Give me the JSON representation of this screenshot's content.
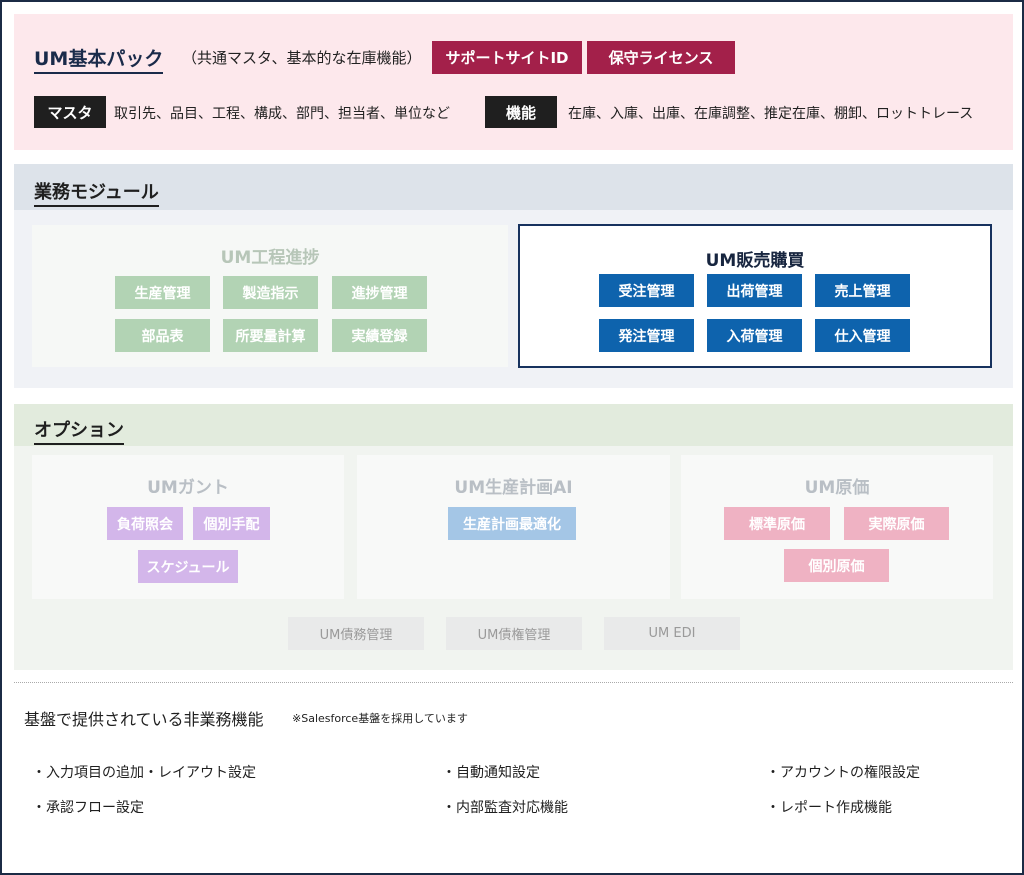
{
  "basic_pack": {
    "title": "UM基本パック",
    "subtitle": "（共通マスタ、基本的な在庫機能）",
    "badges": [
      "サポートサイトID",
      "保守ライセンス"
    ],
    "master_label": "マスタ",
    "master_items": "取引先、品目、工程、構成、部門、担当者、単位など",
    "function_label": "機能",
    "function_items": "在庫、入庫、出庫、在庫調整、推定在庫、棚卸、ロットトレース"
  },
  "business_modules": {
    "title": "業務モジュール",
    "process": {
      "title": "UM工程進捗",
      "items": [
        "生産管理",
        "製造指示",
        "進捗管理",
        "部品表",
        "所要量計算",
        "実績登録"
      ]
    },
    "sales": {
      "title": "UM販売購買",
      "items": [
        "受注管理",
        "出荷管理",
        "売上管理",
        "発注管理",
        "入荷管理",
        "仕入管理"
      ]
    }
  },
  "options": {
    "title": "オプション",
    "gantt": {
      "title": "UMガント",
      "items": [
        "負荷照会",
        "個別手配",
        "スケジュール"
      ]
    },
    "ai": {
      "title": "UM生産計画AI",
      "items": [
        "生産計画最適化"
      ]
    },
    "cost": {
      "title": "UM原価",
      "items": [
        "標準原価",
        "実際原価",
        "個別原価"
      ]
    },
    "extra": [
      "UM債務管理",
      "UM債権管理",
      "UM EDI"
    ]
  },
  "infra": {
    "title": "基盤で提供されている非業務機能",
    "note": "※Salesforce基盤を採用しています",
    "features": [
      "・入力項目の追加・レイアウト設定",
      "・自動通知設定",
      "・アカウントの権限設定",
      "・承認フロー設定",
      "・内部監査対応機能",
      "・レポート作成機能"
    ]
  },
  "colors": {
    "accent_red": "#a3204a",
    "navy": "#1a2b4a",
    "blue": "#0e63ad",
    "green_inactive": "#b2d3b4",
    "purple": "#d3b6ea",
    "light_blue": "#a4c6e6",
    "pink": "#efb2c3"
  }
}
